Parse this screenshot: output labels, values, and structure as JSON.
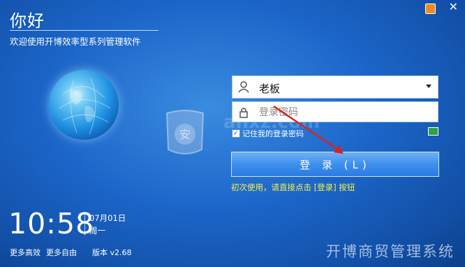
{
  "header": {
    "title": "你好",
    "subtitle": "欢迎使用开博效率型系列管理软件"
  },
  "login": {
    "username_value": "老板",
    "password_placeholder": "登录密码",
    "remember_label": "记住我的登录密码",
    "remember_checked": true,
    "login_button": "登 录 (L)",
    "hint": "初次使用，请直接点击 [登录] 按钮"
  },
  "clock": {
    "time": "10:58",
    "date": "07月01日",
    "weekday": "周一"
  },
  "footer": {
    "link1": "更多高效",
    "link2": "更多自由",
    "version": "版本 v2.68",
    "brand": "开博商贸管理系统"
  },
  "watermark": "anxz.com",
  "icons": {
    "rss": "rss-icon",
    "close": "close-icon",
    "user": "user-icon",
    "lock": "lock-icon",
    "monitor": "monitor-icon",
    "shield": "shield-icon",
    "globe": "globe-icon"
  },
  "colors": {
    "background": "#1c66c9",
    "hint": "#f7f04a",
    "button": "#3d8fee",
    "arrow": "#e0201a"
  }
}
